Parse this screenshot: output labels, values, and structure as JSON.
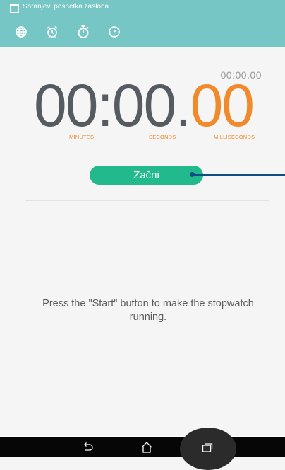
{
  "status_bar": {
    "notification_text": "Shranjev. posnetka zaslona ...",
    "notification_icon": "screenshot-icon"
  },
  "tabs": [
    {
      "name": "world-clock",
      "icon": "globe-icon"
    },
    {
      "name": "alarm",
      "icon": "alarm-clock-icon"
    },
    {
      "name": "stopwatch",
      "icon": "stopwatch-icon",
      "selected": true
    },
    {
      "name": "timer",
      "icon": "timer-icon"
    }
  ],
  "stopwatch": {
    "lap_time": "00:00.00",
    "minutes": "00",
    "seconds": "00",
    "milliseconds": "00",
    "sep1": ":",
    "sep2": ".",
    "minutes_label": "MINUTES",
    "seconds_label": "SECONDS",
    "milliseconds_label": "MILLISECONDS"
  },
  "start_button": {
    "label": "Začni"
  },
  "hint_text": "Press the \"Start\" button to make the stopwatch running.",
  "colors": {
    "header": "#75c6c5",
    "accent_orange": "#f08a2b",
    "button_green": "#22b98d",
    "callout": "#0f4e85"
  },
  "navbar": {
    "buttons": [
      "back-icon",
      "home-icon",
      "recent-apps-icon"
    ]
  }
}
